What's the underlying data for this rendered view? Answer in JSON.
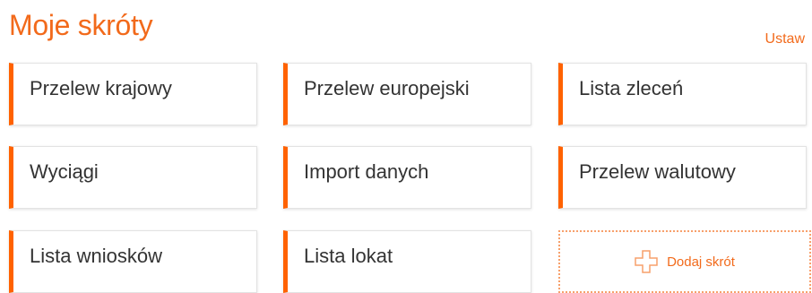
{
  "header": {
    "title": "Moje skróty",
    "set_label": "Ustaw"
  },
  "shortcuts": [
    {
      "label": "Przelew krajowy"
    },
    {
      "label": "Przelew europejski"
    },
    {
      "label": "Lista zleceń"
    },
    {
      "label": "Wyciągi"
    },
    {
      "label": "Import danych"
    },
    {
      "label": "Przelew walutowy"
    },
    {
      "label": "Lista wniosków"
    },
    {
      "label": "Lista lokat"
    }
  ],
  "add_shortcut": {
    "label": "Dodaj skrót",
    "icon": "plus-icon"
  },
  "colors": {
    "accent": "#ff6200",
    "title": "#f26a1b",
    "text": "#333333"
  }
}
